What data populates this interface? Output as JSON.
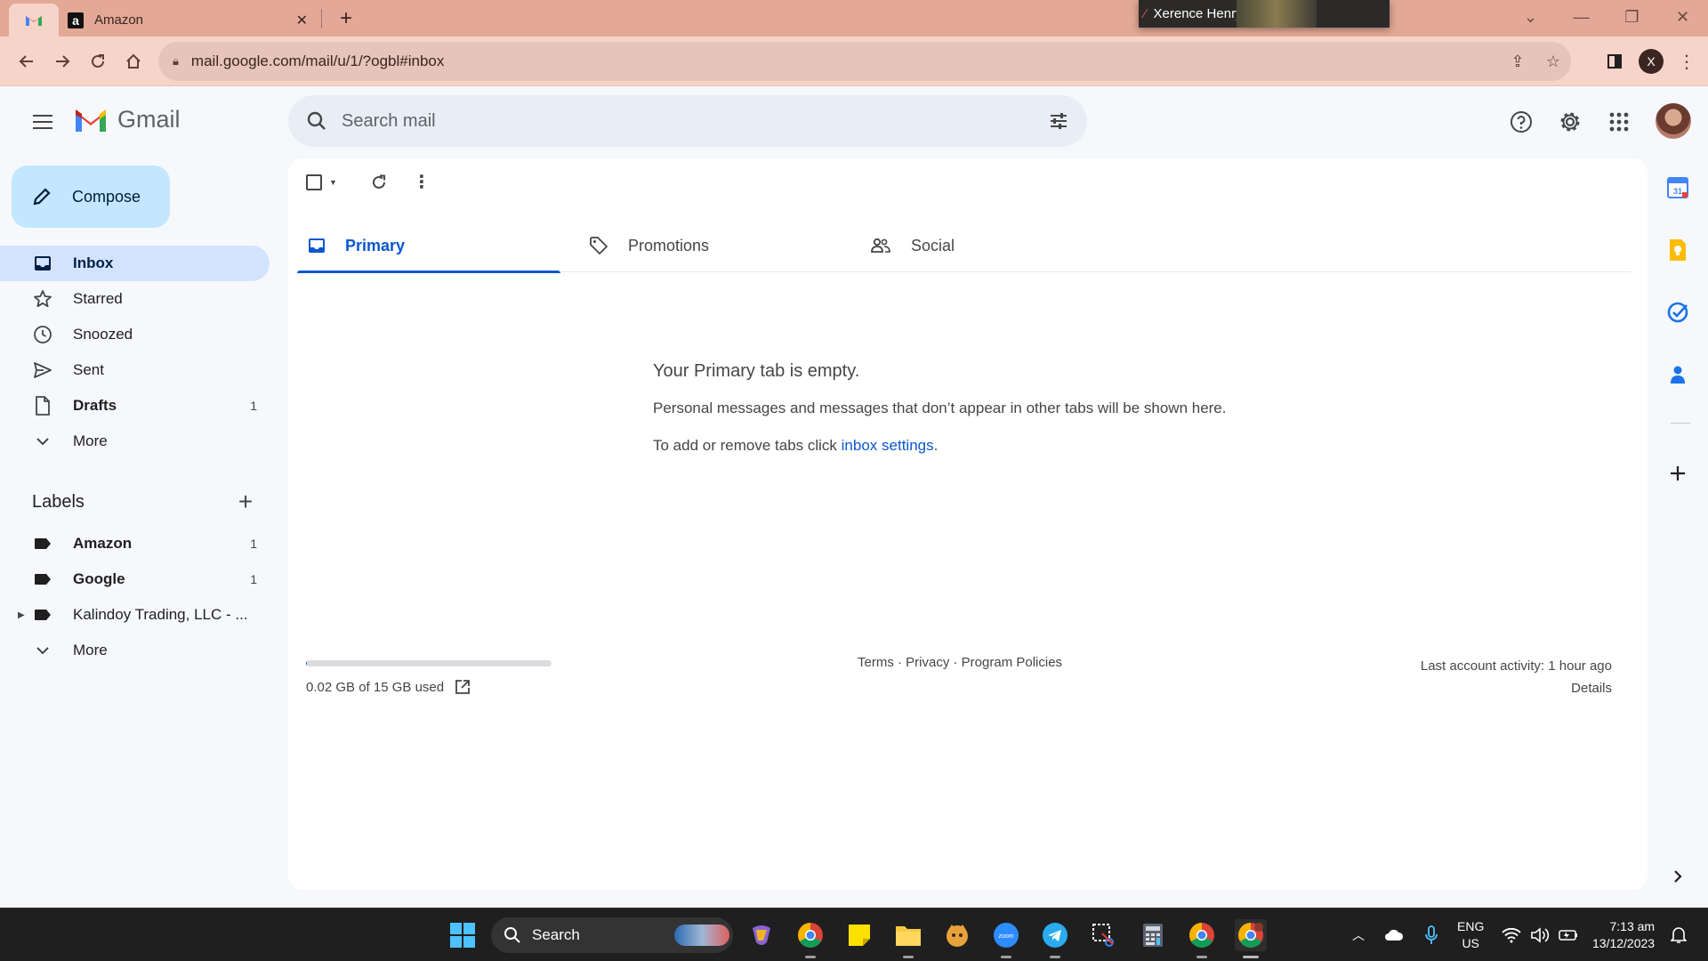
{
  "browser": {
    "tabs": [
      {
        "label": "",
        "favicon": "gmail-icon",
        "active": true
      },
      {
        "label": "Amazon",
        "favicon": "amazon-icon",
        "active": false
      }
    ],
    "url": "mail.google.com/mail/u/1/?ogbl#inbox",
    "profile_initial": "X",
    "video_call_name": "Xerence Henry"
  },
  "gmail": {
    "brand": "Gmail",
    "search_placeholder": "Search mail",
    "compose_label": "Compose",
    "nav": [
      {
        "label": "Inbox",
        "icon": "inbox-icon",
        "count": ""
      },
      {
        "label": "Starred",
        "icon": "star-icon",
        "count": ""
      },
      {
        "label": "Snoozed",
        "icon": "clock-icon",
        "count": ""
      },
      {
        "label": "Sent",
        "icon": "send-icon",
        "count": ""
      },
      {
        "label": "Drafts",
        "icon": "draft-icon",
        "count": "1"
      },
      {
        "label": "More",
        "icon": "chevron-down-icon",
        "count": ""
      }
    ],
    "labels_title": "Labels",
    "labels": [
      {
        "label": "Amazon",
        "count": "1"
      },
      {
        "label": "Google",
        "count": "1"
      },
      {
        "label": "Kalindoy Trading, LLC - ...",
        "count": ""
      },
      {
        "label": "More",
        "count": ""
      }
    ],
    "category_tabs": [
      {
        "label": "Primary",
        "icon": "inbox-icon"
      },
      {
        "label": "Promotions",
        "icon": "tag-icon"
      },
      {
        "label": "Social",
        "icon": "people-icon"
      }
    ],
    "empty_state": {
      "heading": "Your Primary tab is empty.",
      "line1": "Personal messages and messages that don’t appear in other tabs will be shown here.",
      "line2_prefix": "To add or remove tabs click ",
      "line2_link": "inbox settings",
      "line2_suffix": "."
    },
    "storage": {
      "text": "0.02 GB of 15 GB used",
      "fraction": 0.0013
    },
    "footer_links": "Terms · Privacy · Program Policies",
    "activity": {
      "text": "Last account activity: 1 hour ago",
      "details": "Details"
    }
  },
  "taskbar": {
    "search_label": "Search",
    "lang_top": "ENG",
    "lang_bottom": "US",
    "time": "7:13 am",
    "date": "13/12/2023"
  },
  "colors": {
    "accent": "#0b57d0",
    "compose_bg": "#c2e7ff",
    "active_nav_bg": "#d3e3fd",
    "tabstrip_bg": "#e3a896"
  }
}
